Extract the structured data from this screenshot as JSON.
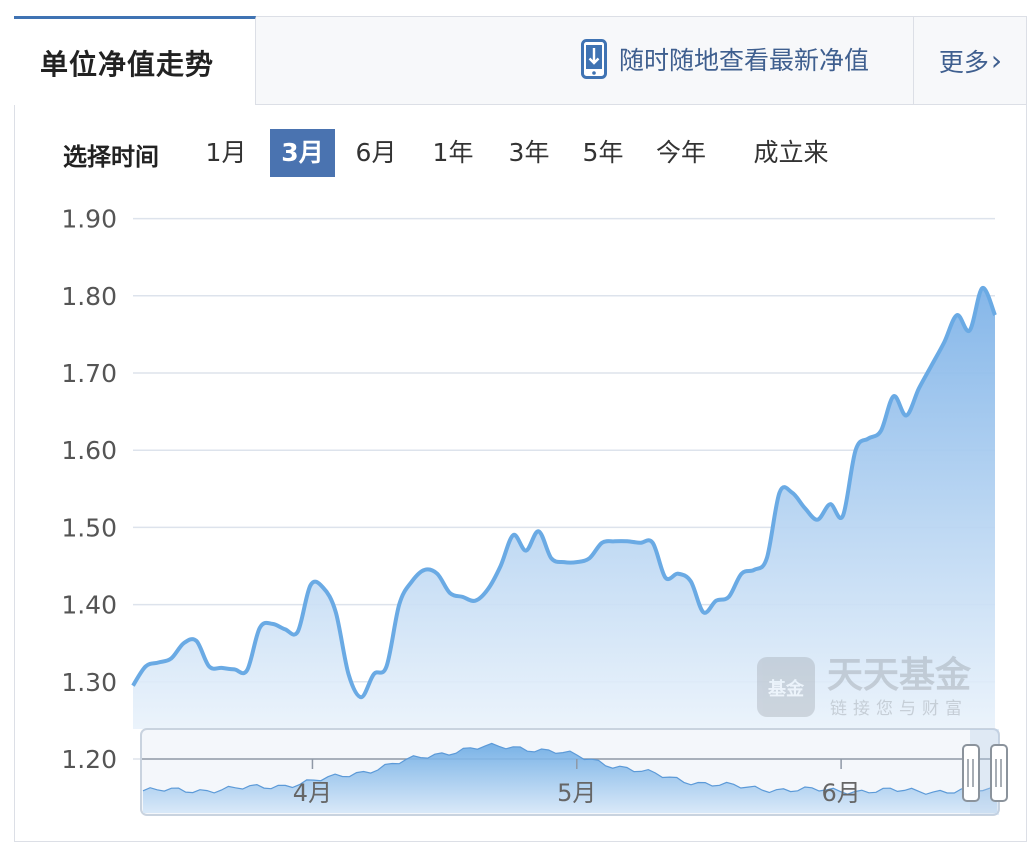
{
  "header": {
    "tab_title": "单位净值走势",
    "promo_text": "随时随地查看最新净值",
    "more_label": "更多",
    "more_chevron": "›"
  },
  "range_selector": {
    "label": "选择时间",
    "options": [
      "1月",
      "3月",
      "6月",
      "1年",
      "3年",
      "5年",
      "今年",
      "成立来"
    ],
    "selected": "3月"
  },
  "watermark": {
    "logo_text": "基金",
    "brand": "天天基金",
    "slogan": "链接您与财富"
  },
  "icons": {
    "promo_icon": "phone-download-icon",
    "more_icon": "chevron-right-icon"
  },
  "colors": {
    "accent": "#4a73b0",
    "line": "#6aaae4",
    "area_top": "#7fb3e8",
    "area_bottom": "#e9f2fb",
    "grid": "#dde3ec"
  },
  "chart_data": {
    "type": "area",
    "title": "",
    "xlabel": "",
    "ylabel": "",
    "ylim": [
      1.15,
      1.9
    ],
    "y_ticks": [
      1.2,
      1.3,
      1.4,
      1.5,
      1.6,
      1.7,
      1.8,
      1.9
    ],
    "y_tick_labels": [
      "1.20",
      "1.30",
      "1.40",
      "1.50",
      "1.60",
      "1.70",
      "1.80",
      "1.90"
    ],
    "x_index_range": [
      0,
      63
    ],
    "grid": true,
    "series": [
      {
        "values": [
          1.295,
          1.32,
          1.325,
          1.33,
          1.35,
          1.353,
          1.32,
          1.318,
          1.316,
          1.315,
          1.37,
          1.375,
          1.368,
          1.365,
          1.425,
          1.422,
          1.39,
          1.31,
          1.28,
          1.31,
          1.32,
          1.4,
          1.43,
          1.445,
          1.44,
          1.415,
          1.41,
          1.405,
          1.42,
          1.45,
          1.49,
          1.47,
          1.495,
          1.46,
          1.455,
          1.455,
          1.46,
          1.48,
          1.482,
          1.482,
          1.48,
          1.48,
          1.435,
          1.44,
          1.43,
          1.39,
          1.405,
          1.41,
          1.44,
          1.445,
          1.46,
          1.545,
          1.545,
          1.525,
          1.51,
          1.53,
          1.515,
          1.6,
          1.615,
          1.625,
          1.67,
          1.645,
          1.68,
          1.71,
          1.74,
          1.775,
          1.755,
          1.81,
          1.775
        ]
      }
    ],
    "navigator": {
      "x_tick_labels": [
        "4月",
        "5月",
        "6月"
      ],
      "x_tick_positions": [
        12.5,
        32.0,
        51.5
      ],
      "selected_range": "1月"
    }
  }
}
